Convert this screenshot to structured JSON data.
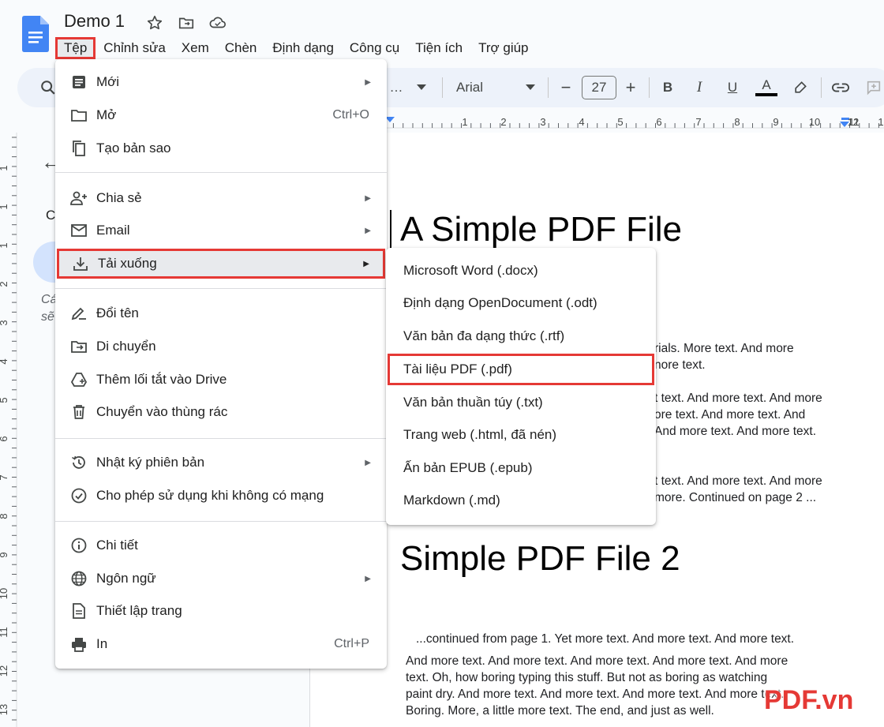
{
  "app": {
    "title": "Demo 1"
  },
  "menubar": [
    "Tệp",
    "Chỉnh sửa",
    "Xem",
    "Chèn",
    "Định dạng",
    "Công cụ",
    "Tiện ích",
    "Trợ giúp"
  ],
  "toolbar": {
    "font": "Arial",
    "font_size": "27",
    "minus": "−",
    "plus": "+",
    "bold": "B",
    "italic": "I",
    "underline": "U",
    "text_color": "A"
  },
  "ruler": {
    "h_ticks": [
      "1",
      "1",
      "2",
      "3",
      "4",
      "5",
      "6",
      "7",
      "8",
      "9",
      "10",
      "11",
      "12",
      "1"
    ],
    "v_ticks": [
      "1",
      "1",
      "1",
      "2",
      "3",
      "4",
      "5",
      "6",
      "7",
      "8",
      "9",
      "10",
      "11",
      "12",
      "13"
    ]
  },
  "side_panel": {
    "frag1": "C",
    "frag2": "Cá",
    "frag3": "sẽ"
  },
  "file_menu": {
    "items": [
      {
        "label": "Mới",
        "shortcut": "",
        "submenu": true,
        "icon": "doc-icon"
      },
      {
        "label": "Mở",
        "shortcut": "Ctrl+O",
        "submenu": false,
        "icon": "folder-icon"
      },
      {
        "label": "Tạo bản sao",
        "shortcut": "",
        "submenu": false,
        "icon": "copy-icon"
      },
      {
        "label": "Chia sẻ",
        "shortcut": "",
        "submenu": true,
        "icon": "person-add-icon"
      },
      {
        "label": "Email",
        "shortcut": "",
        "submenu": true,
        "icon": "mail-icon"
      },
      {
        "label": "Tải xuống",
        "shortcut": "",
        "submenu": true,
        "icon": "download-icon"
      },
      {
        "label": "Đổi tên",
        "shortcut": "",
        "submenu": false,
        "icon": "rename-icon"
      },
      {
        "label": "Di chuyển",
        "shortcut": "",
        "submenu": false,
        "icon": "move-folder-icon"
      },
      {
        "label": "Thêm lối tắt vào Drive",
        "shortcut": "",
        "submenu": false,
        "icon": "drive-shortcut-icon"
      },
      {
        "label": "Chuyển vào thùng rác",
        "shortcut": "",
        "submenu": false,
        "icon": "trash-icon"
      },
      {
        "label": "Nhật ký phiên bản",
        "shortcut": "",
        "submenu": true,
        "icon": "history-icon"
      },
      {
        "label": "Cho phép sử dụng khi không có mạng",
        "shortcut": "",
        "submenu": false,
        "icon": "offline-icon"
      },
      {
        "label": "Chi tiết",
        "shortcut": "",
        "submenu": false,
        "icon": "info-icon"
      },
      {
        "label": "Ngôn ngữ",
        "shortcut": "",
        "submenu": true,
        "icon": "globe-icon"
      },
      {
        "label": "Thiết lập trang",
        "shortcut": "",
        "submenu": false,
        "icon": "page-setup-icon"
      },
      {
        "label": "In",
        "shortcut": "Ctrl+P",
        "submenu": false,
        "icon": "print-icon"
      }
    ]
  },
  "download_menu": {
    "items": [
      "Microsoft Word (.docx)",
      "Định dạng OpenDocument (.odt)",
      "Văn bản đa dạng thức (.rtf)",
      "Tài liệu PDF (.pdf)",
      "Văn bản thuần túy (.txt)",
      "Trang web (.html, đã nén)",
      "Ấn bản EPUB (.epub)",
      "Markdown (.md)"
    ]
  },
  "document": {
    "heading1": "A Simple PDF File",
    "heading2": "Simple PDF File 2",
    "visible_lines": [
      "rials. More text. And more",
      "nore text.",
      "t text. And more text. And more",
      "ore text. And more text. And",
      "And more text. And more text.",
      "t text. And more text. And more",
      "more. Continued on page 2 ...",
      "...continued from page 1. Yet more text. And more text. And more text.",
      "And more text. And more text. And more text. And more text. And more",
      "text. Oh, how boring typing this stuff. But not as boring as watching",
      "paint dry. And more text. And more text. And more text. And more text.",
      "Boring. More, a little more text. The end, and just as well."
    ]
  },
  "watermark": "PDF.vn",
  "colors": {
    "highlight_border": "#e53935",
    "docs_blue": "#4285f4"
  }
}
